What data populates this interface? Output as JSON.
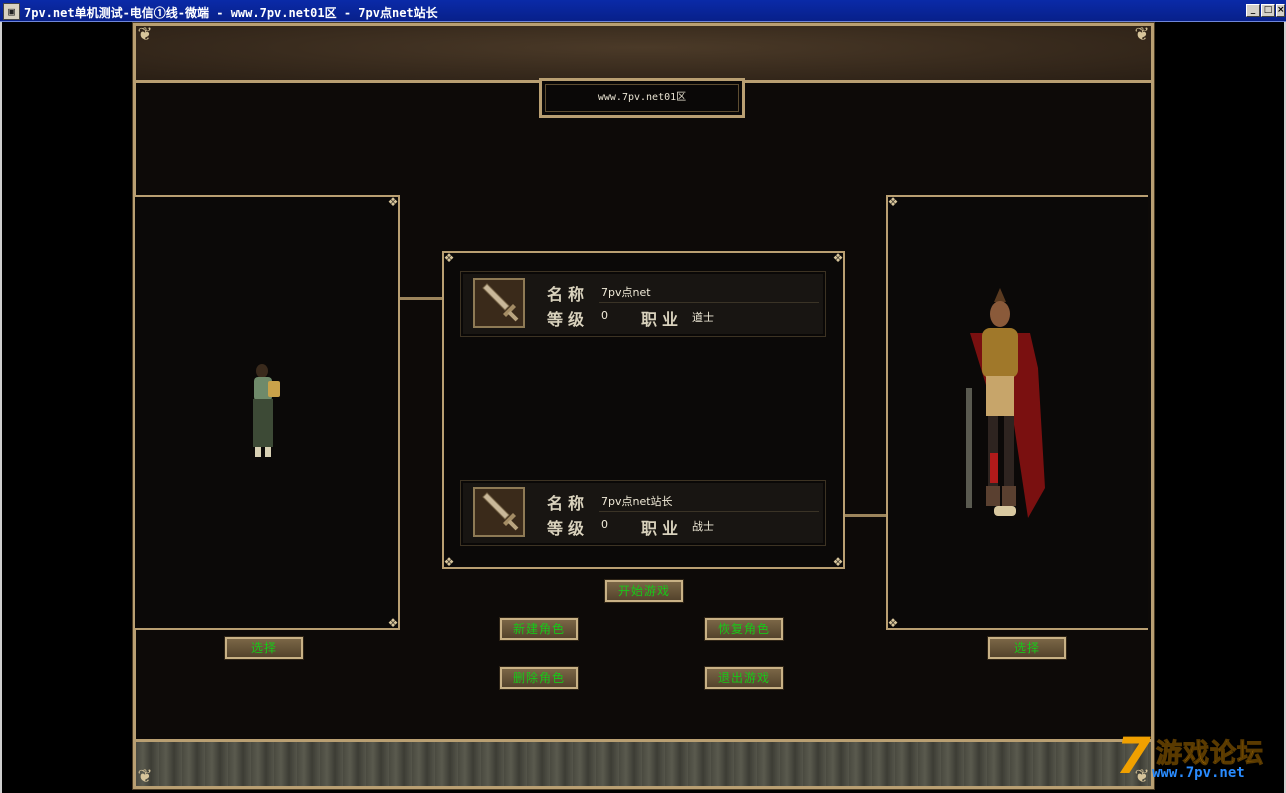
{
  "window": {
    "icon": "app-icon",
    "title": "7pv.net单机测试-电信①线-微端 - www.7pv.net01区 - 7pv点net站长",
    "min_glyph": "_",
    "max_glyph": "□",
    "close_glyph": "×"
  },
  "server": {
    "name": "www.7pv.net01区"
  },
  "labels": {
    "name": "名称",
    "level": "等级",
    "class": "职业"
  },
  "characters": [
    {
      "name": "7pv点net",
      "level": "0",
      "class": "道士",
      "icon": "sword-icon"
    },
    {
      "name": "7pv点net站长",
      "level": "0",
      "class": "战士",
      "icon": "sword-icon"
    }
  ],
  "buttons": {
    "select_left": "选择",
    "select_right": "选择",
    "start_game": "开始游戏",
    "new_character": "新建角色",
    "restore_character": "恢复角色",
    "delete_character": "删除角色",
    "exit_game": "退出游戏"
  },
  "watermark": {
    "digit": "7",
    "title": "游戏论坛",
    "url": "www.7pv.net"
  },
  "colors": {
    "frame_gold": "#b99f72",
    "button_text": "#18c818",
    "background": "#0d0a08"
  }
}
